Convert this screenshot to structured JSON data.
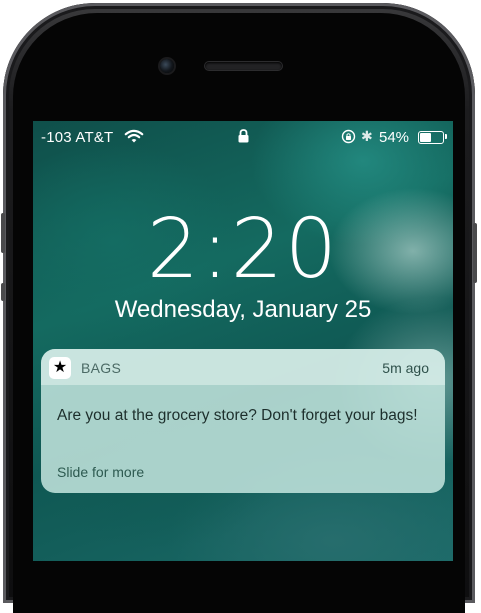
{
  "status_bar": {
    "carrier": "-103 AT&T",
    "battery_percent": "54%",
    "battery_level": 0.54,
    "icons": [
      "wifi-icon",
      "lock-icon",
      "orientation-lock-icon",
      "bluetooth-icon",
      "battery-icon"
    ]
  },
  "lock_screen": {
    "time": "2:20",
    "date": "Wednesday, January 25"
  },
  "notification": {
    "app_icon": "star-icon",
    "app_name": "BAGS",
    "time_ago": "5m ago",
    "message": "Are you at the grocery store? Don't forget your bags!",
    "action_hint": "Slide for more"
  }
}
